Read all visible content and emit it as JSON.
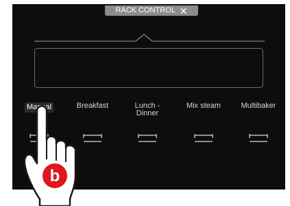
{
  "header": {
    "title": "RACK CONTROL",
    "close_icon": "close-icon"
  },
  "modes": [
    {
      "label": "Manual",
      "icon": "rack-icon",
      "active": true
    },
    {
      "label": "Breakfast",
      "icon": "rack-icon",
      "active": false
    },
    {
      "label": "Lunch -\nDinner",
      "icon": "rack-icon",
      "active": false
    },
    {
      "label": "Mix steam",
      "icon": "rack-icon",
      "active": false
    },
    {
      "label": "Multibaker",
      "icon": "rack-icon",
      "active": false
    }
  ],
  "overlay": {
    "badge_letter": "b",
    "badge_color": "#e0161f",
    "icon": "pointing-hand-icon"
  },
  "colors": {
    "screen_bg": "#0d0d0d",
    "pill_bg": "#8c8c8c",
    "outline": "#6d6d6d"
  }
}
